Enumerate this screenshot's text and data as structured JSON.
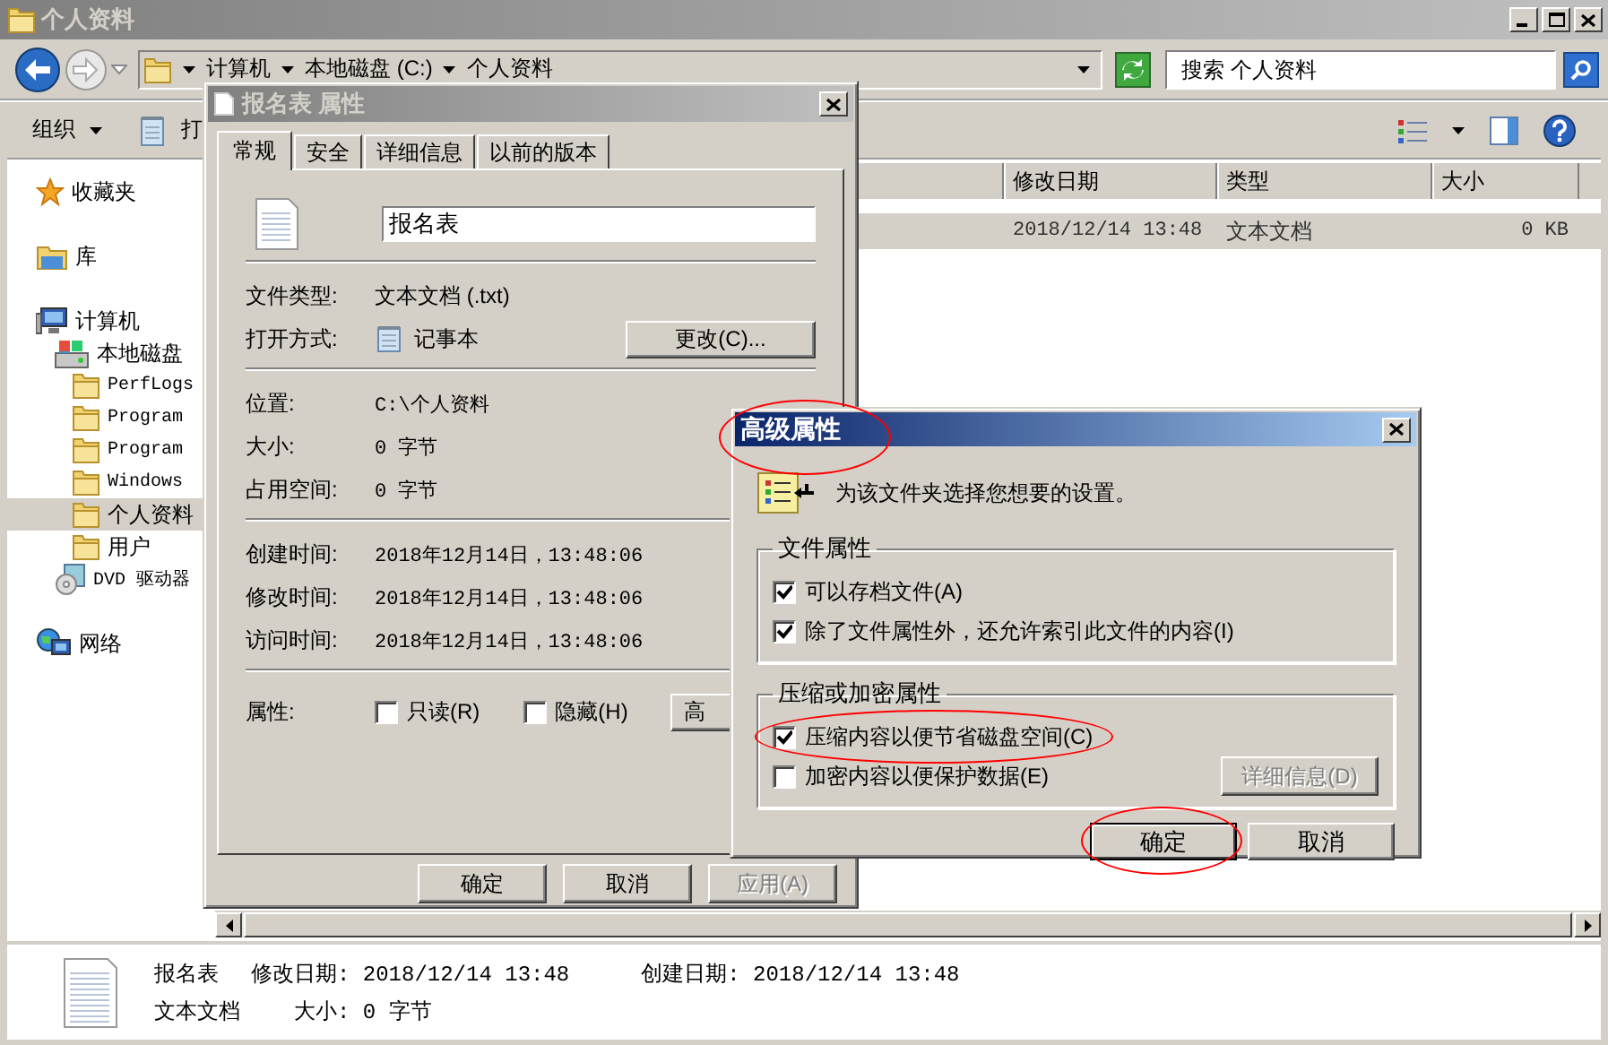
{
  "window": {
    "title": "个人资料"
  },
  "address": {
    "crumbs": [
      "计算机",
      "本地磁盘 (C:)",
      "个人资料"
    ]
  },
  "search": {
    "placeholder": "搜索 个人资料"
  },
  "toolbar": {
    "items": [
      {
        "label": "组织",
        "kind": "menu"
      },
      {
        "label": "打",
        "kind": "open"
      }
    ]
  },
  "sidebar": {
    "items": [
      {
        "label": "收藏夹",
        "kind": "star",
        "selected": false
      },
      {
        "label": "库",
        "kind": "library",
        "selected": false
      },
      {
        "label": "计算机",
        "kind": "computer",
        "selected": false,
        "children": [
          {
            "label": "本地磁盘",
            "kind": "drive",
            "selected": false,
            "children": [
              {
                "label": "PerfLogs",
                "kind": "folder",
                "selected": false
              },
              {
                "label": "Program",
                "kind": "folder",
                "selected": false
              },
              {
                "label": "Program",
                "kind": "folder",
                "selected": false
              },
              {
                "label": "Windows",
                "kind": "folder",
                "selected": false
              },
              {
                "label": "个人资料",
                "kind": "folder",
                "selected": true
              },
              {
                "label": "用户",
                "kind": "folder",
                "selected": false
              }
            ]
          },
          {
            "label": "DVD 驱动器",
            "kind": "dvd",
            "selected": false
          }
        ]
      },
      {
        "label": "网络",
        "kind": "network",
        "selected": false
      }
    ]
  },
  "file_list": {
    "columns": [
      "修改日期",
      "类型",
      "大小"
    ],
    "rows": [
      {
        "cells": [
          "2018/12/14 13:48",
          "文本文档",
          "0 KB"
        ],
        "selected": true
      }
    ]
  },
  "details_pane": {
    "name": "报名表",
    "type": "文本文档",
    "fields": [
      "修改日期: 2018/12/14 13:48",
      "创建日期: 2018/12/14 13:48",
      "大小: 0 字节"
    ]
  },
  "properties_dialog": {
    "title": "报名表 属性",
    "tabs": [
      {
        "label": "常规",
        "selected": true
      },
      {
        "label": "安全",
        "selected": false
      },
      {
        "label": "详细信息",
        "selected": false
      },
      {
        "label": "以前的版本",
        "selected": false
      }
    ],
    "file_name": "报名表",
    "sections": [
      [
        {
          "label": "文件类型:",
          "value": "文本文档 (.txt)"
        },
        {
          "label": "打开方式:",
          "value": "记事本",
          "kind": "app",
          "button": "更改(C)..."
        }
      ],
      [
        {
          "label": "位置:",
          "value": "C:\\个人资料"
        },
        {
          "label": "大小:",
          "value": "0 字节"
        },
        {
          "label": "占用空间:",
          "value": "0 字节"
        }
      ],
      [
        {
          "label": "创建时间:",
          "value": "2018年12月14日，13:48:06"
        },
        {
          "label": "修改时间:",
          "value": "2018年12月14日，13:48:06"
        },
        {
          "label": "访问时间:",
          "value": "2018年12月14日，13:48:06"
        }
      ]
    ],
    "attributes": {
      "label": "属性:",
      "checkboxes": [
        {
          "label": "只读(R)",
          "checked": false
        },
        {
          "label": "隐藏(H)",
          "checked": false
        }
      ],
      "button": "高"
    },
    "buttons": [
      {
        "label": "确定",
        "disabled": false
      },
      {
        "label": "取消",
        "disabled": false
      },
      {
        "label": "应用(A)",
        "disabled": true
      }
    ]
  },
  "advanced_dialog": {
    "title": "高级属性",
    "circled": true,
    "message": "为该文件夹选择您想要的设置。",
    "groups": [
      {
        "title": "文件属性",
        "options": [
          {
            "label": "可以存档文件(A)",
            "checked": true,
            "circled": false
          },
          {
            "label": "除了文件属性外，还允许索引此文件的内容(I)",
            "checked": true,
            "circled": false
          }
        ]
      },
      {
        "title": "压缩或加密属性",
        "options": [
          {
            "label": "压缩内容以便节省磁盘空间(C)",
            "checked": true,
            "circled": true
          },
          {
            "label": "加密内容以便保护数据(E)",
            "checked": false,
            "circled": false
          }
        ],
        "button": {
          "label": "详细信息(D)",
          "disabled": true
        }
      }
    ],
    "buttons": [
      {
        "label": "确定",
        "circled": true,
        "default": true
      },
      {
        "label": "取消",
        "circled": false,
        "default": false
      }
    ]
  }
}
